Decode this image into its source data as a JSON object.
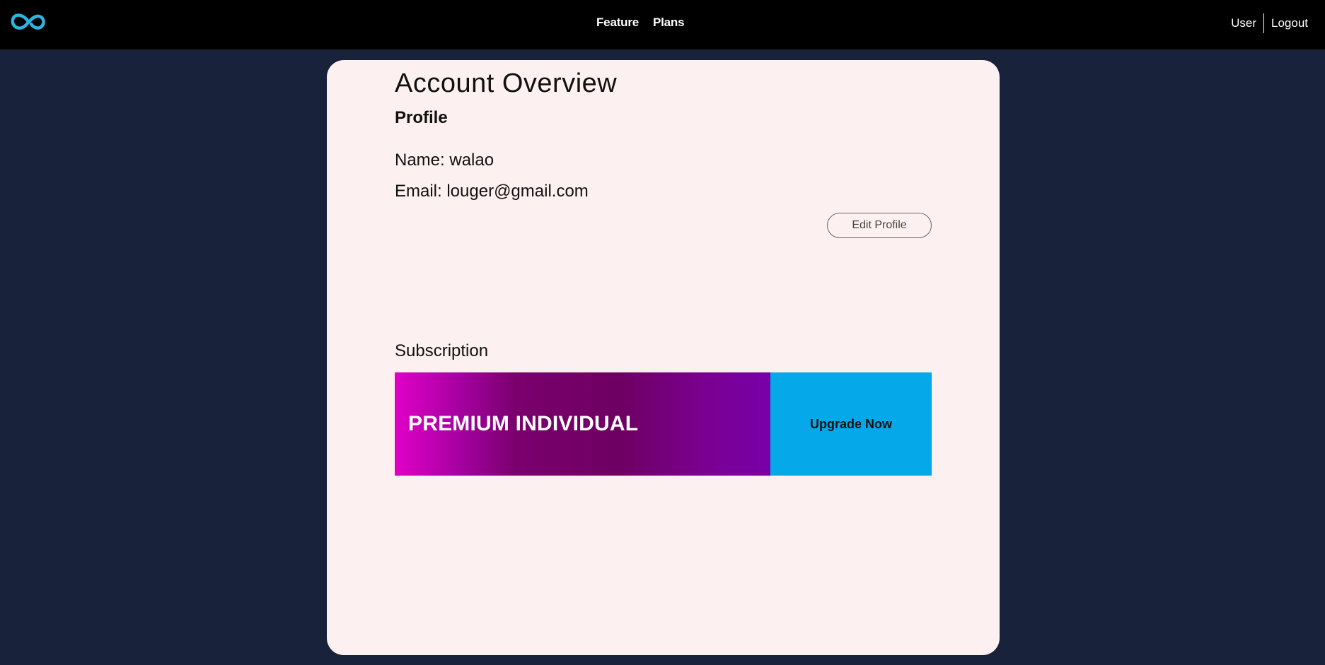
{
  "header": {
    "logo_icon": "infinity-logo-icon",
    "nav": [
      {
        "label": "Feature"
      },
      {
        "label": "Plans"
      }
    ],
    "user_label": "User",
    "logout_label": "Logout"
  },
  "account": {
    "title": "Account Overview",
    "profile_heading": "Profile",
    "name_line": "Name: walao",
    "email_line": "Email: louger@gmail.com",
    "edit_label": "Edit Profile"
  },
  "subscription": {
    "heading": "Subscription",
    "plan_name": "PREMIUM INDIVIDUAL",
    "upgrade_label": "Upgrade Now"
  },
  "colors": {
    "page_bg": "#19223b",
    "header_bg": "#000000",
    "card_bg": "#fdf0f0",
    "logo": "#2bb6e0",
    "upgrade_bg": "#05a8e8",
    "plan_gradient_start": "#e100c8",
    "plan_gradient_end": "#7800a8"
  }
}
